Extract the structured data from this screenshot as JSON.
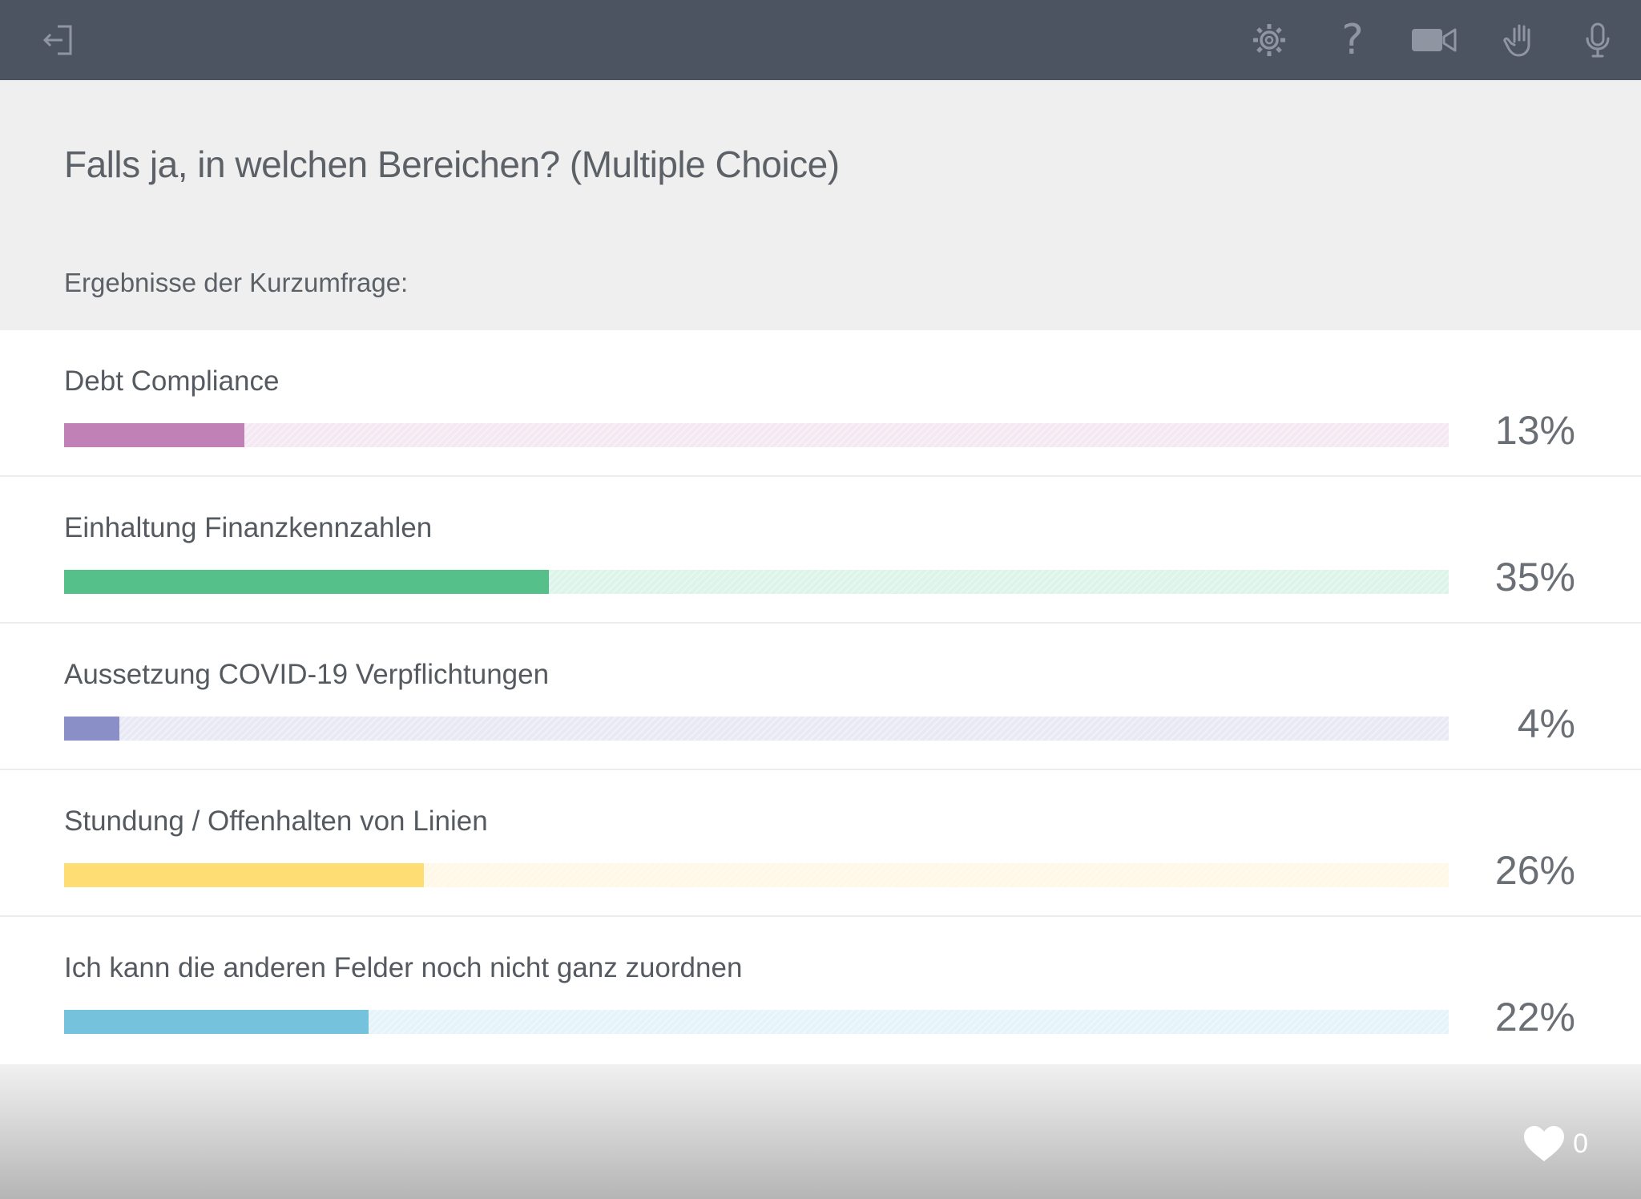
{
  "topbar": {
    "icons": [
      "exit-icon",
      "gear-icon",
      "help-icon",
      "video-camera-icon",
      "raise-hand-icon",
      "microphone-icon"
    ],
    "help_glyph": "?"
  },
  "question": "Falls ja, in welchen Bereichen? (Multiple Choice)",
  "results_title": "Ergebnisse der Kurzumfrage:",
  "results": [
    {
      "label": "Debt Compliance",
      "percent": 13,
      "percent_label": "13%",
      "color": "#bf81b6",
      "track_color": "#f4e9f3"
    },
    {
      "label": "Einhaltung Finanzkennzahlen",
      "percent": 35,
      "percent_label": "35%",
      "color": "#55c08a",
      "track_color": "#dcf4ea"
    },
    {
      "label": "Aussetzung COVID-19 Verpflichtungen",
      "percent": 4,
      "percent_label": "4%",
      "color": "#8a8fc8",
      "track_color": "#e9e9f6"
    },
    {
      "label": "Stundung / Offenhalten von Linien",
      "percent": 26,
      "percent_label": "26%",
      "color": "#fedd74",
      "track_color": "#fff8e6"
    },
    {
      "label": "Ich kann die anderen Felder noch nicht ganz zuordnen",
      "percent": 22,
      "percent_label": "22%",
      "color": "#75c2dc",
      "track_color": "#e5f4fa"
    }
  ],
  "footer": {
    "like_count": "0",
    "like_icon": "heart-icon"
  }
}
